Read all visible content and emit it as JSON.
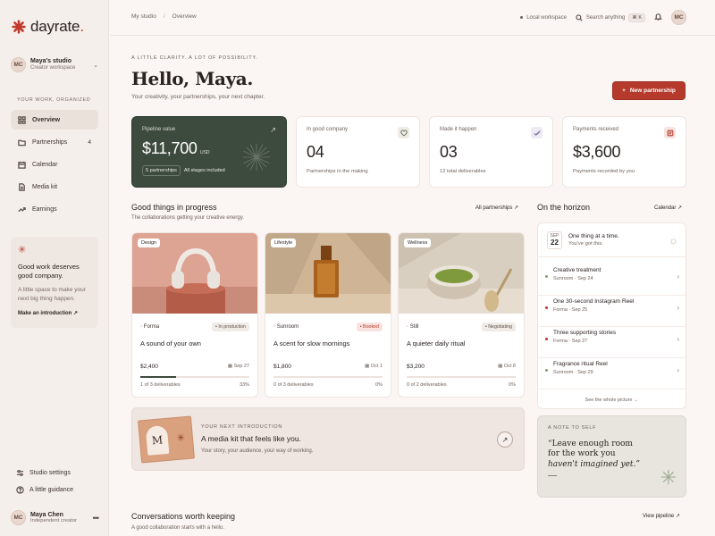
{
  "brand": {
    "name": "dayrate",
    "accent": "#c0392b"
  },
  "studio": {
    "initials": "MC",
    "name": "Maya's studio",
    "sub": "Creator workspace"
  },
  "sidebar": {
    "section_label": "YOUR WORK, ORGANIZED",
    "items": [
      {
        "label": "Overview",
        "icon": "grid-icon"
      },
      {
        "label": "Partnerships",
        "icon": "folder-icon",
        "count": "4"
      },
      {
        "label": "Calendar",
        "icon": "calendar-icon"
      },
      {
        "label": "Media kit",
        "icon": "document-icon"
      },
      {
        "label": "Earnings",
        "icon": "trend-icon"
      }
    ],
    "promo": {
      "title": "Good work deserves good company.",
      "text": "A little space to make your next big thing happen.",
      "link": "Make an introduction"
    },
    "bottom": [
      {
        "label": "Studio settings",
        "icon": "sliders-icon"
      },
      {
        "label": "A little guidance",
        "icon": "help-icon"
      }
    ],
    "user": {
      "initials": "MC",
      "name": "Maya Chen",
      "role": "Independent creator"
    }
  },
  "topbar": {
    "crumbs": [
      "My studio",
      "Overview"
    ],
    "workspace": "Local workspace",
    "search": "Search anything",
    "shortcut": "⌘ K",
    "user_initials": "MC"
  },
  "header": {
    "eyebrow": "A LITTLE CLARITY. A LOT OF POSSIBILITY.",
    "title": "Hello, Maya.",
    "subtitle": "Your creativity, your partnerships, your next chapter.",
    "new_button": "New partnership"
  },
  "stats": {
    "pipeline": {
      "label": "Pipeline value",
      "value": "$11,700",
      "unit": "USD",
      "chip1": "5 partnerships",
      "chip2": "All stages included"
    },
    "good_company": {
      "label": "In good company",
      "value": "04",
      "sub": "Partnerships in the making"
    },
    "made": {
      "label": "Made it happen",
      "value": "03",
      "sub": "12 total deliverables"
    },
    "payments": {
      "label": "Payments received",
      "value": "$3,600",
      "sub": "Payments recorded by you"
    }
  },
  "progress_section": {
    "title": "Good things in progress",
    "subtitle": "The collaborations getting your creative energy.",
    "link": "All partnerships"
  },
  "cards": [
    {
      "tag": "Design",
      "brand": "Forma",
      "status": "In production",
      "title": "A sound of your own",
      "amount": "$2,400",
      "date": "Sep 27",
      "deliverables": "1 of 3 deliverables",
      "pct": "33%",
      "progress": 0.33
    },
    {
      "tag": "Lifestyle",
      "brand": "Sunroom",
      "status": "Booked",
      "title": "A scent for slow mornings",
      "amount": "$1,800",
      "date": "Oct 1",
      "deliverables": "0 of 3 deliverables",
      "pct": "0%",
      "progress": 0
    },
    {
      "tag": "Wellness",
      "brand": "Still",
      "status": "Negotiating",
      "title": "A quieter daily ritual",
      "amount": "$3,200",
      "date": "Oct 8",
      "deliverables": "0 of 2 deliverables",
      "pct": "0%",
      "progress": 0
    }
  ],
  "intro": {
    "eyebrow": "YOUR NEXT INTRODUCTION",
    "title": "A media kit that feels like you.",
    "subtitle": "Your story, your audience, your way of working.",
    "art_letter": "M"
  },
  "horizon": {
    "title": "On the horizon",
    "link": "Calendar",
    "month": "SEP",
    "day": "22",
    "head_title": "One thing at a time.",
    "head_sub": "You've got this.",
    "items": [
      {
        "title": "Creative treatment",
        "brand": "Sunroom",
        "date": "Sep 24"
      },
      {
        "title": "One 30-second Instagram Reel",
        "brand": "Forma",
        "date": "Sep 25"
      },
      {
        "title": "Three supporting stories",
        "brand": "Forma",
        "date": "Sep 27"
      },
      {
        "title": "Fragrance ritual Reel",
        "brand": "Sunroom",
        "date": "Sep 29"
      }
    ],
    "foot": "See the whole picture"
  },
  "note": {
    "eyebrow": "A NOTE TO SELF",
    "line1": "“Leave enough room",
    "line2": "for the work you",
    "line3": "haven't imagined yet.”"
  },
  "conversations": {
    "title": "Conversations worth keeping",
    "subtitle": "A good collaboration starts with a hello.",
    "link": "View pipeline"
  }
}
